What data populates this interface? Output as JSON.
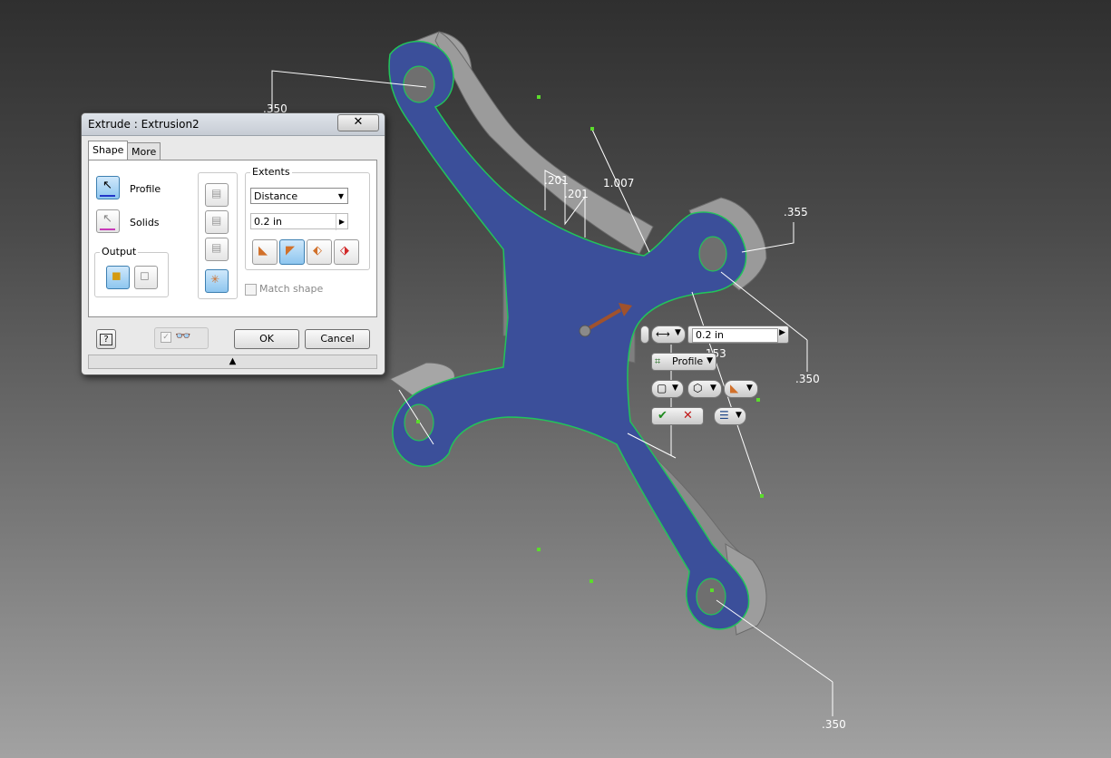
{
  "dialog": {
    "title": "Extrude : Extrusion2",
    "close_glyph": "✕",
    "tabs": [
      "Shape",
      "More"
    ],
    "profile_label": "Profile",
    "solids_label": "Solids",
    "output_label": "Output",
    "extents_label": "Extents",
    "extents_type": "Distance",
    "distance_value": "0.2 in",
    "match_shape_label": "Match shape",
    "ok_label": "OK",
    "cancel_label": "Cancel",
    "help_glyph": "?",
    "expand_glyph": "▲"
  },
  "mini_toolbar": {
    "distance_value": "0.2 in",
    "profile_label": "Profile",
    "ok_glyph": "✔",
    "cancel_glyph": "✕"
  },
  "dimensions": {
    "d_350_top": ".350",
    "d_201_a": ".201",
    "d_201_b": ".201",
    "d_1007": "1.007",
    "d_355": ".355",
    "d_350_right": ".350",
    "d_153": ".153",
    "d_350_bottom": ".350"
  },
  "colors": {
    "face": "#3b4f9a",
    "edge": "#22c45a",
    "side": "#8f8f8f",
    "accent": "#3c7fb1"
  }
}
